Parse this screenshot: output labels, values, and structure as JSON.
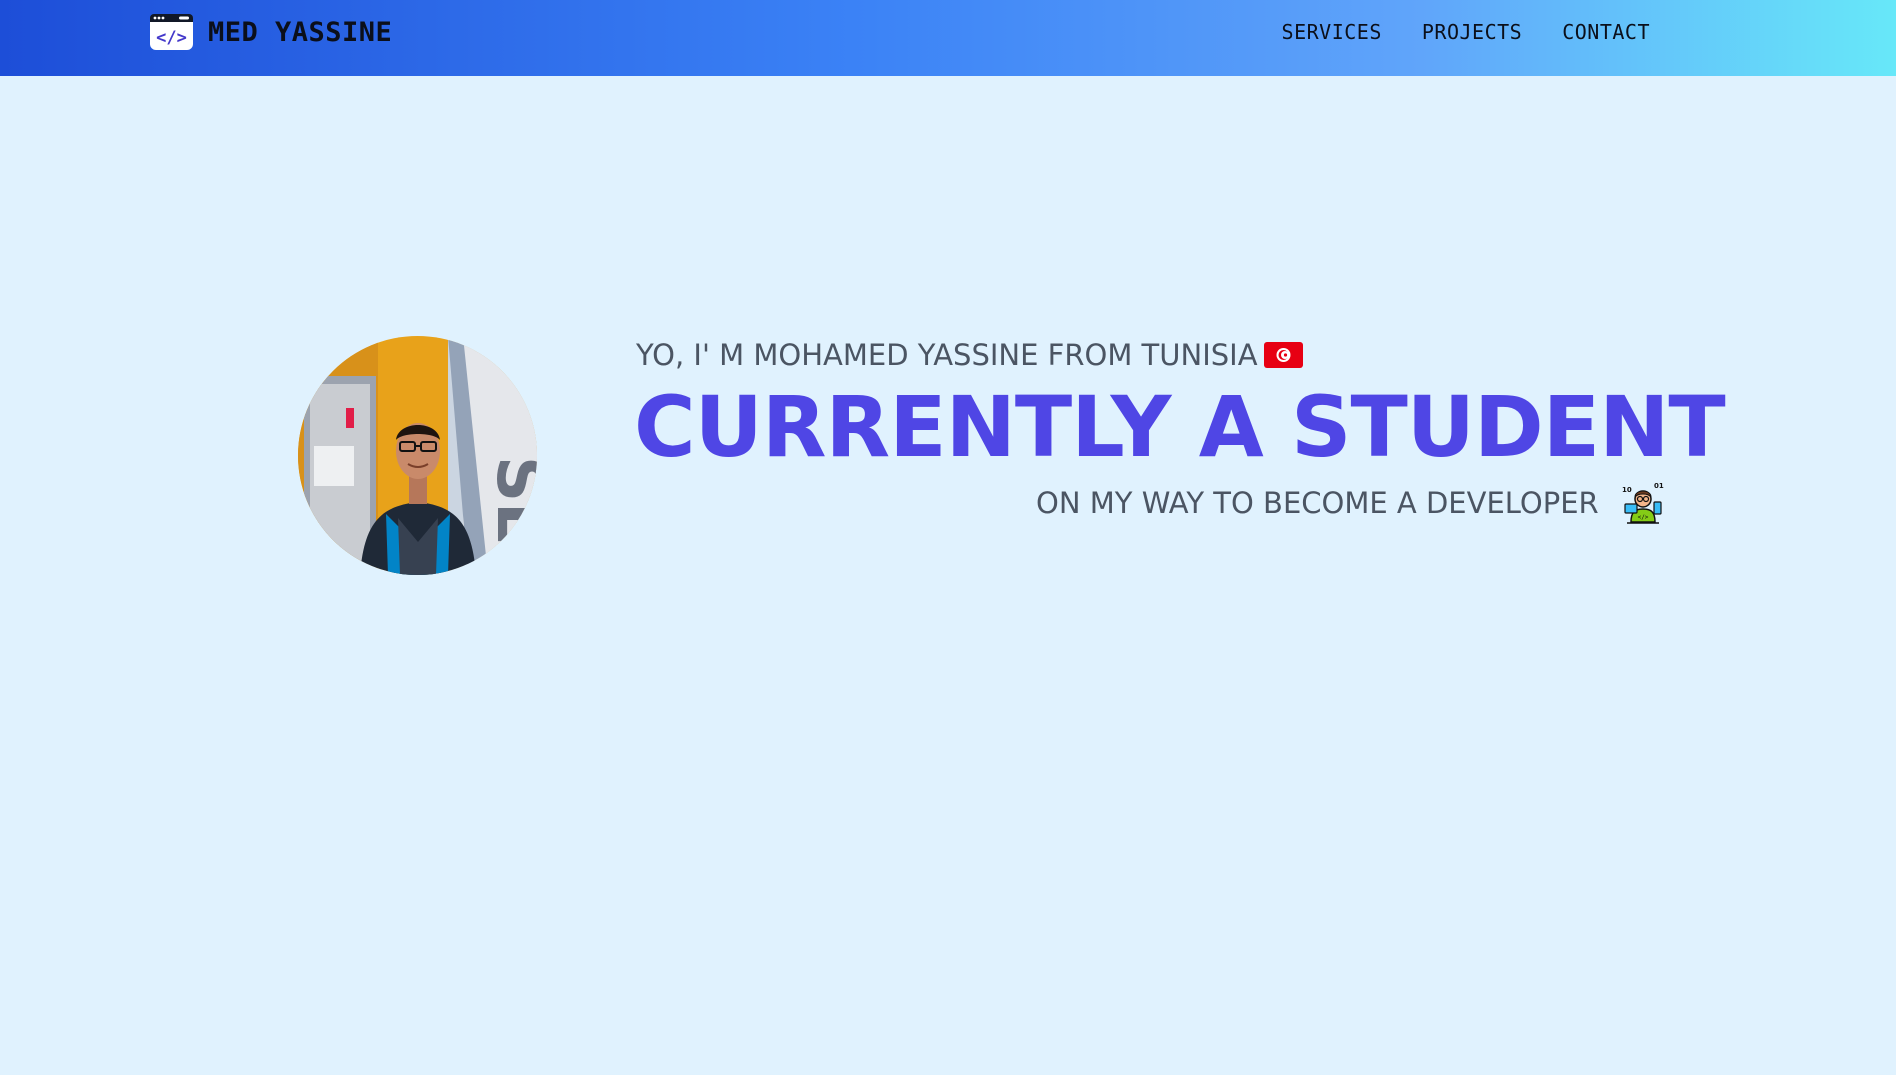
{
  "navbar": {
    "brand_name": "MED YASSINE",
    "logo_icon": "code-window-icon",
    "links": [
      {
        "label": "SERVICES"
      },
      {
        "label": "PROJECTS"
      },
      {
        "label": "CONTACT"
      }
    ]
  },
  "hero": {
    "intro": "YO, I' M MOHAMED YASSINE FROM TUNISIA",
    "flag_icon": "tunisia-flag-icon",
    "headline": "CURRENTLY A STUDENT",
    "subline": "ON MY WAY TO BECOME A DEVELOPER",
    "developer_icon": "developer-icon"
  },
  "colors": {
    "headline": "#4f46e5",
    "background": "#e0f2fe",
    "nav_gradient_start": "#1d4ed8",
    "nav_gradient_end": "#67e8f9",
    "text": "#4b5563"
  }
}
